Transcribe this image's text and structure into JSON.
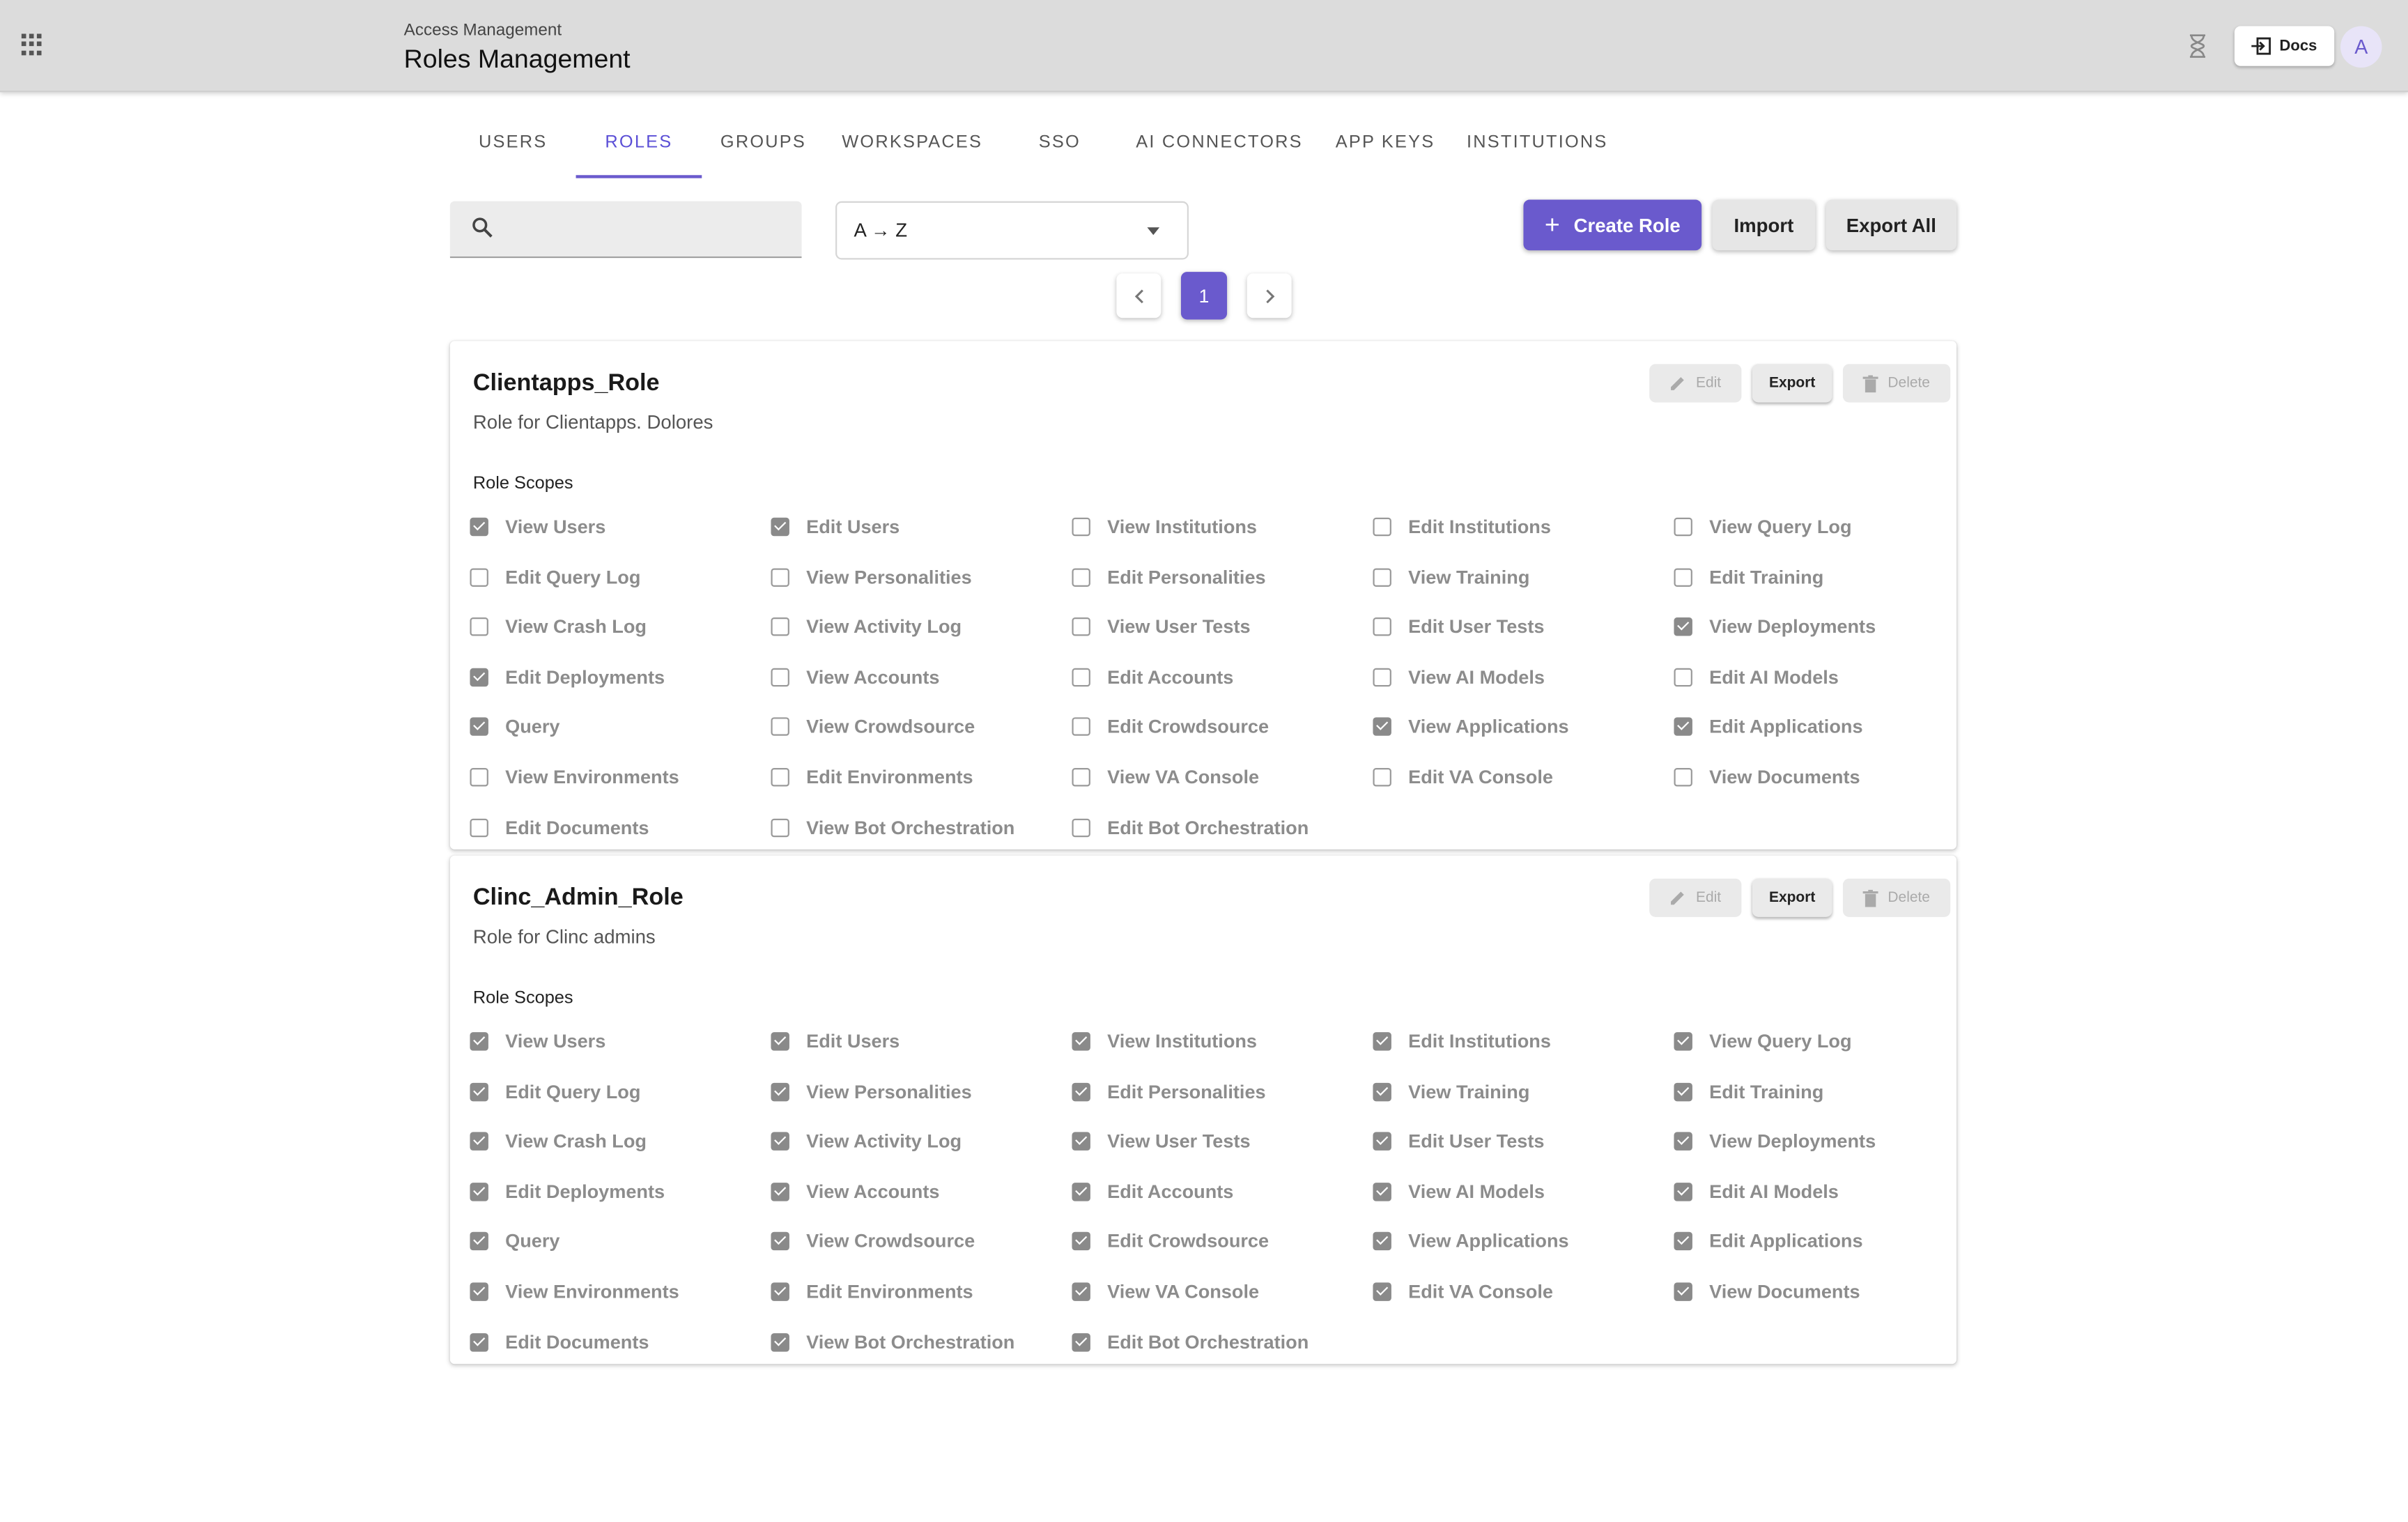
{
  "header": {
    "breadcrumb": "Access Management",
    "title": "Roles Management",
    "docs_label": "Docs",
    "avatar_initial": "A",
    "menu_icon": "apps-grid-icon",
    "status_icon": "hourglass-icon"
  },
  "tabs": [
    {
      "label": "USERS",
      "active": false
    },
    {
      "label": "ROLES",
      "active": true
    },
    {
      "label": "GROUPS",
      "active": false
    },
    {
      "label": "WORKSPACES",
      "active": false
    },
    {
      "label": "SSO",
      "active": false
    },
    {
      "label": "AI CONNECTORS",
      "active": false
    },
    {
      "label": "APP KEYS",
      "active": false
    },
    {
      "label": "INSTITUTIONS",
      "active": false
    }
  ],
  "toolbar": {
    "search_placeholder": "",
    "search_value": "",
    "sort_value": "A → Z",
    "create_label": "Create Role",
    "import_label": "Import",
    "export_all_label": "Export All"
  },
  "pagination": {
    "current": "1"
  },
  "card_actions": {
    "edit": "Edit",
    "export": "Export",
    "delete": "Delete",
    "scopes_heading": "Role Scopes"
  },
  "roles": [
    {
      "name": "Clientapps_Role",
      "description": "Role for Clientapps. Dolores",
      "scopes": [
        {
          "label": "View Users",
          "checked": true
        },
        {
          "label": "Edit Users",
          "checked": true
        },
        {
          "label": "View Institutions",
          "checked": false
        },
        {
          "label": "Edit Institutions",
          "checked": false
        },
        {
          "label": "View Query Log",
          "checked": false
        },
        {
          "label": "Edit Query Log",
          "checked": false
        },
        {
          "label": "View Personalities",
          "checked": false
        },
        {
          "label": "Edit Personalities",
          "checked": false
        },
        {
          "label": "View Training",
          "checked": false
        },
        {
          "label": "Edit Training",
          "checked": false
        },
        {
          "label": "View Crash Log",
          "checked": false
        },
        {
          "label": "View Activity Log",
          "checked": false
        },
        {
          "label": "View User Tests",
          "checked": false
        },
        {
          "label": "Edit User Tests",
          "checked": false
        },
        {
          "label": "View Deployments",
          "checked": true
        },
        {
          "label": "Edit Deployments",
          "checked": true
        },
        {
          "label": "View Accounts",
          "checked": false
        },
        {
          "label": "Edit Accounts",
          "checked": false
        },
        {
          "label": "View AI Models",
          "checked": false
        },
        {
          "label": "Edit AI Models",
          "checked": false
        },
        {
          "label": "Query",
          "checked": true
        },
        {
          "label": "View Crowdsource",
          "checked": false
        },
        {
          "label": "Edit Crowdsource",
          "checked": false
        },
        {
          "label": "View Applications",
          "checked": true
        },
        {
          "label": "Edit Applications",
          "checked": true
        },
        {
          "label": "View Environments",
          "checked": false
        },
        {
          "label": "Edit Environments",
          "checked": false
        },
        {
          "label": "View VA Console",
          "checked": false
        },
        {
          "label": "Edit VA Console",
          "checked": false
        },
        {
          "label": "View Documents",
          "checked": false
        },
        {
          "label": "Edit Documents",
          "checked": false
        },
        {
          "label": "View Bot Orchestration",
          "checked": false
        },
        {
          "label": "Edit Bot Orchestration",
          "checked": false
        }
      ]
    },
    {
      "name": "Clinc_Admin_Role",
      "description": "Role for Clinc admins",
      "scopes": [
        {
          "label": "View Users",
          "checked": true
        },
        {
          "label": "Edit Users",
          "checked": true
        },
        {
          "label": "View Institutions",
          "checked": true
        },
        {
          "label": "Edit Institutions",
          "checked": true
        },
        {
          "label": "View Query Log",
          "checked": true
        },
        {
          "label": "Edit Query Log",
          "checked": true
        },
        {
          "label": "View Personalities",
          "checked": true
        },
        {
          "label": "Edit Personalities",
          "checked": true
        },
        {
          "label": "View Training",
          "checked": true
        },
        {
          "label": "Edit Training",
          "checked": true
        },
        {
          "label": "View Crash Log",
          "checked": true
        },
        {
          "label": "View Activity Log",
          "checked": true
        },
        {
          "label": "View User Tests",
          "checked": true
        },
        {
          "label": "Edit User Tests",
          "checked": true
        },
        {
          "label": "View Deployments",
          "checked": true
        },
        {
          "label": "Edit Deployments",
          "checked": true
        },
        {
          "label": "View Accounts",
          "checked": true
        },
        {
          "label": "Edit Accounts",
          "checked": true
        },
        {
          "label": "View AI Models",
          "checked": true
        },
        {
          "label": "Edit AI Models",
          "checked": true
        },
        {
          "label": "Query",
          "checked": true
        },
        {
          "label": "View Crowdsource",
          "checked": true
        },
        {
          "label": "Edit Crowdsource",
          "checked": true
        },
        {
          "label": "View Applications",
          "checked": true
        },
        {
          "label": "Edit Applications",
          "checked": true
        },
        {
          "label": "View Environments",
          "checked": true
        },
        {
          "label": "Edit Environments",
          "checked": true
        },
        {
          "label": "View VA Console",
          "checked": true
        },
        {
          "label": "Edit VA Console",
          "checked": true
        },
        {
          "label": "View Documents",
          "checked": true
        },
        {
          "label": "Edit Documents",
          "checked": true
        },
        {
          "label": "View Bot Orchestration",
          "checked": true
        },
        {
          "label": "Edit Bot Orchestration",
          "checked": true
        }
      ]
    }
  ],
  "colors": {
    "accent": "#6a5acd",
    "appbar": "#dcdcdc",
    "checkbox_checked": "#8a8a8a"
  }
}
